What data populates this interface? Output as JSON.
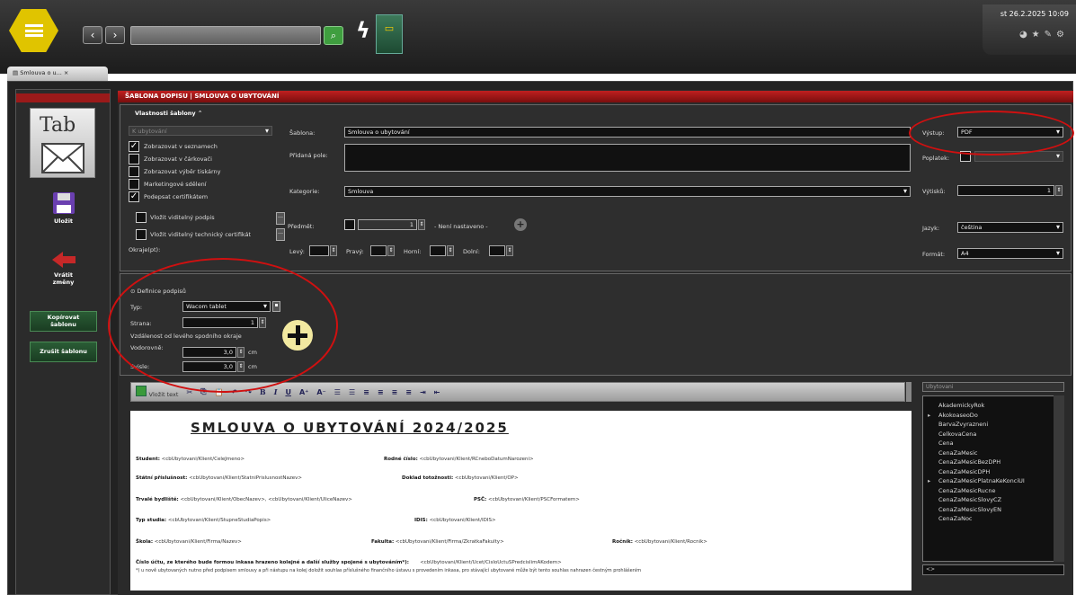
{
  "header": {
    "datetime": "st 26.2.2025 10:09",
    "tab_label": "Smlouva o u...",
    "tab_close": "×"
  },
  "sidebar": {
    "tab_icon_text": "Tab",
    "save_label": "Uložit",
    "revert_label": "Vrátit změny",
    "copy_label": "Kopírovat šablonu",
    "cancel_label": "Zrušit šablonu"
  },
  "title": "ŠABLONA DOPISU | SMLOUVA O UBYTOVÁNÍ",
  "properties": {
    "section_label": "Vlastnosti šablony",
    "category_dd": "K ubytování",
    "checkboxes": [
      {
        "label": "Zobrazovat v seznamech",
        "checked": true
      },
      {
        "label": "Zobrazovat v čárkovači",
        "checked": false
      },
      {
        "label": "Zobrazovat výběr tiskárny",
        "checked": false
      },
      {
        "label": "Marketingové sdělení",
        "checked": false
      },
      {
        "label": "Podepsat certifikátem",
        "checked": true
      },
      {
        "label": "Vložit viditelný podpis",
        "checked": false
      },
      {
        "label": "Vložit viditelný technický certifikát",
        "checked": false
      }
    ],
    "margins_label": "Okraje(pt):",
    "sablona_label": "Šablona:",
    "sablona_value": "Smlouva o ubytování",
    "extra_fields_label": "Přidaná pole:",
    "category_label": "Kategorie:",
    "category_value": "Smlouva",
    "subject_label": "Předmět:",
    "subject_num": "1",
    "subject_status": "- Není nastaveno -",
    "left_label": "Levý:",
    "right_label": "Pravý:",
    "top_label": "Horní:",
    "bottom_label": "Dolní:",
    "output_label": "Výstup:",
    "output_value": "PDF",
    "fee_label": "Poplatek:",
    "prints_label": "Výtisků:",
    "prints_value": "1",
    "lang_label": "Jazyk:",
    "lang_value": "čeština",
    "format_label": "Formát:",
    "format_value": "A4"
  },
  "signature": {
    "section_label": "Definice podpisů",
    "type_label": "Typ:",
    "type_value": "Wacom tablet",
    "page_label": "Strana:",
    "page_value": "1",
    "distance_label": "Vzdálenost od levého spodního okraje",
    "horizontal_label": "Vodorovně:",
    "horizontal_value": "3,0",
    "vertical_label": "Svisle:",
    "vertical_value": "3,0",
    "unit": "cm"
  },
  "toolbar": {
    "insert_label": "Vložit text"
  },
  "document": {
    "heading": "SMLOUVA O UBYTOVÁNÍ 2024/2025",
    "student_label": "Student:",
    "student_value": "<cbUbytovani/Klient/CeleJmeno>",
    "birthno_label": "Rodné číslo:",
    "birthno_value": "<cbUbytovani/Klient/RCneboDatumNarozeni>",
    "nationality_label": "Státní příslušnost:",
    "nationality_value": "<cbUbytovani/Klient/StatniPrislusnostNazev>",
    "id_label": "Doklad totožnosti:",
    "id_value": "<cbUbytovani/Klient/OP>",
    "address_label": "Trvalé bydliště:",
    "address_value": "<cbUbytovani/Klient/ObecNazev>, <cbUbytovani/Klient/UliceNazev>",
    "zip_label": "PSČ:",
    "zip_value": "<cbUbytovani/Klient/PSCFormatem>",
    "study_label": "Typ studia:",
    "study_value": "<cbUbytovani/Klient/StupneStudiaPopis>",
    "idis_label": "IDIS:",
    "idis_value": "<cbUbytovani/Klient/IDIS>",
    "school_label": "Škola:",
    "school_value": "<cbUbytovani/Klient/Firma/Nazev>",
    "faculty_label": "Fakulta:",
    "faculty_value": "<cbUbytovani/Klient/Firma/ZkratkaFakulty>",
    "year_label": "Ročník:",
    "year_value": "<cbUbytovani/Klient/Rocnik>",
    "account_label": "Číslo účtu, ze kterého bude formou inkasa hrazeno kolejné a další služby spojené s ubytováním*):",
    "account_value": "<cbUbytovani/Klient/Ucet/CisloUctuSPredcislimAKodem>",
    "footnote": "*) u nově ubytovaných nutno před podpisem smlouvy a při nástupu na kolej doložit souhlas příslušného finančního ústavu s provedením inkasa, pro stávající ubytované může být tento souhlas nahrazen čestným prohlášením"
  },
  "tree": {
    "dropdown": "Ubytovani",
    "items": [
      {
        "label": "AkademickyRok",
        "expandable": false
      },
      {
        "label": "AkokoaseoDo",
        "expandable": true
      },
      {
        "label": "BarvaZvyrazneni",
        "expandable": false
      },
      {
        "label": "CelkovaCena",
        "expandable": false
      },
      {
        "label": "Cena",
        "expandable": false
      },
      {
        "label": "CenaZaMesic",
        "expandable": false
      },
      {
        "label": "CenaZaMesicBezDPH",
        "expandable": false
      },
      {
        "label": "CenaZaMesicDPH",
        "expandable": false
      },
      {
        "label": "CenaZaMesicPlatnaKeKonciUI",
        "expandable": true
      },
      {
        "label": "CenaZaMesicRucne",
        "expandable": false
      },
      {
        "label": "CenaZaMesicSlovyCZ",
        "expandable": false
      },
      {
        "label": "CenaZaMesicSlovyEN",
        "expandable": false
      },
      {
        "label": "CenaZaNoc",
        "expandable": false
      }
    ],
    "bottom": "<>"
  }
}
